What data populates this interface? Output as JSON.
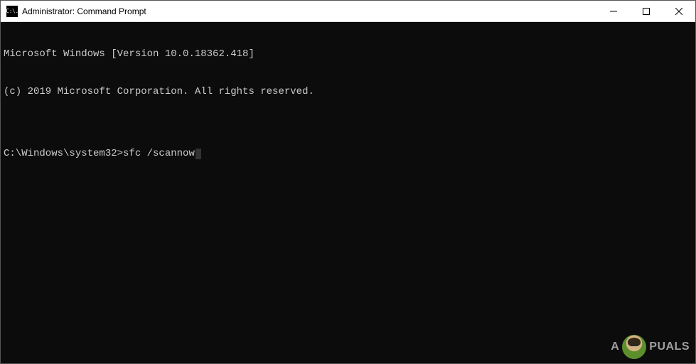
{
  "titlebar": {
    "icon_text": "C:\\.",
    "title": "Administrator: Command Prompt"
  },
  "terminal": {
    "lines": [
      "Microsoft Windows [Version 10.0.18362.418]",
      "(c) 2019 Microsoft Corporation. All rights reserved.",
      "",
      "C:\\Windows\\system32>sfc /scannow"
    ],
    "prompt": "C:\\Windows\\system32>",
    "command": "sfc /scannow"
  },
  "watermark": {
    "text": "A  PUALS"
  }
}
